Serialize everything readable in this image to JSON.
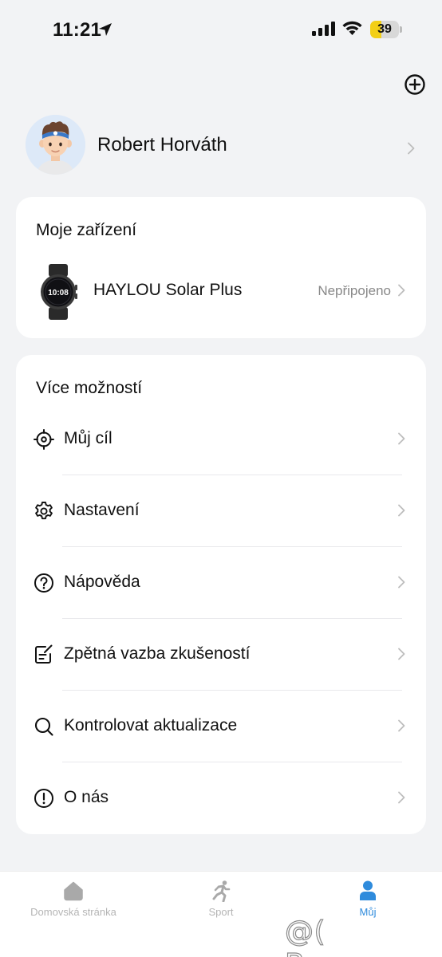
{
  "status_bar": {
    "time": "11:21",
    "battery_level": "39",
    "battery_color": "#f3cf17",
    "icons": [
      "location-arrow-icon",
      "cellular-signal-icon",
      "wifi-icon",
      "battery-icon"
    ]
  },
  "header": {
    "add_icon": "plus-circle-icon"
  },
  "profile": {
    "name": "Robert Horváth",
    "avatar_icon": "avatar-boy-headband"
  },
  "devices": {
    "title": "Moje zařízení",
    "items": [
      {
        "name": "HAYLOU Solar Plus",
        "status": "Nepřipojeno",
        "watch_time": "10:08"
      }
    ]
  },
  "more": {
    "title": "Více možností",
    "items": [
      {
        "label": "Můj cíl",
        "icon": "target-icon"
      },
      {
        "label": "Nastavení",
        "icon": "gear-icon"
      },
      {
        "label": "Nápověda",
        "icon": "help-icon"
      },
      {
        "label": "Zpětná vazba zkušeností",
        "icon": "feedback-icon"
      },
      {
        "label": "Kontrolovat aktualizace",
        "icon": "search-icon"
      },
      {
        "label": "O nás",
        "icon": "info-exclamation-icon"
      }
    ]
  },
  "tabs": [
    {
      "label": "Domovská stránka",
      "icon": "home-icon",
      "active": false
    },
    {
      "label": "Sport",
      "icon": "runner-icon",
      "active": false
    },
    {
      "label": "Můj",
      "icon": "person-icon",
      "active": true
    }
  ],
  "colors": {
    "accent": "#2f8bdc",
    "background": "#f2f3f5",
    "card": "#ffffff",
    "muted_text": "#888888"
  },
  "watermark": "@( Bazos.cz"
}
